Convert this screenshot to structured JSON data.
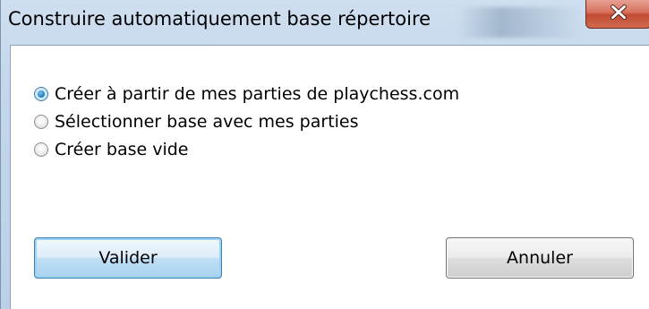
{
  "window": {
    "title": "Construire automatiquement base répertoire",
    "close_glyph": "X"
  },
  "options": [
    {
      "label": "Créer à partir de mes parties de playchess.com",
      "selected": true
    },
    {
      "label": "Sélectionner base avec mes parties",
      "selected": false
    },
    {
      "label": "Créer base vide",
      "selected": false
    }
  ],
  "buttons": {
    "validate_label": "Valider",
    "cancel_label": "Annuler"
  },
  "colors": {
    "title_bar": "#c3d6eb",
    "close_button": "#c24c33",
    "radio_selected": "#2a86c8",
    "default_button_border": "#3c7fb1"
  }
}
